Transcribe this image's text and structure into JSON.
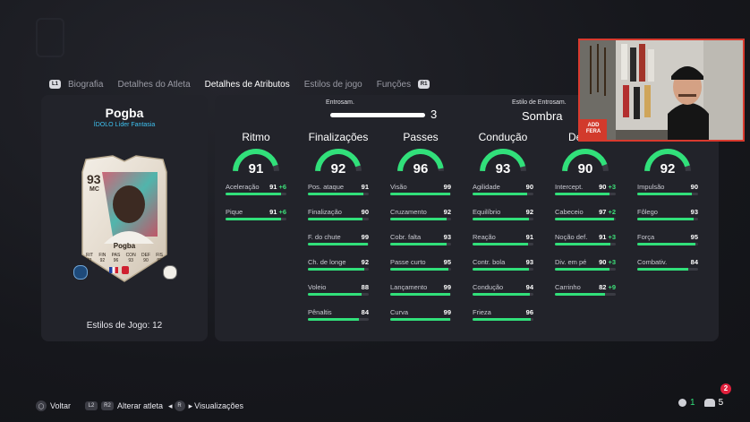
{
  "tabs": {
    "left_button": "L1",
    "right_button": "R1",
    "items": [
      "Biografia",
      "Detalhes do Atleta",
      "Detalhes de Atributos",
      "Estilos de jogo",
      "Funções"
    ],
    "active_index": 2
  },
  "player": {
    "name": "Pogba",
    "tag": "ÍDOLO Líder Fantasia",
    "styles_label": "Estilos de Jogo: 12",
    "card": {
      "rating": "93",
      "position": "MC",
      "name": "Pogba",
      "stat_labels": [
        "RIT",
        "FIN",
        "PAS",
        "CON",
        "DEF",
        "FIS"
      ],
      "stat_values": [
        "91",
        "92",
        "96",
        "93",
        "90",
        "92"
      ]
    }
  },
  "chemistry": {
    "label": "Entrosam.",
    "value": "3",
    "level": 1.0,
    "style_label": "Estilo de Entrosam.",
    "style_value": "Sombra"
  },
  "categories": [
    {
      "title": "Ritmo",
      "value": "91",
      "stats": [
        {
          "label": "Aceleração",
          "value": "91",
          "bonus": "+6"
        },
        {
          "label": "Pique",
          "value": "91",
          "bonus": "+6"
        }
      ]
    },
    {
      "title": "Finalizações",
      "value": "92",
      "stats": [
        {
          "label": "Pos. ataque",
          "value": "91",
          "bonus": ""
        },
        {
          "label": "Finalização",
          "value": "90",
          "bonus": ""
        },
        {
          "label": "F. do chute",
          "value": "99",
          "bonus": ""
        },
        {
          "label": "Ch. de longe",
          "value": "92",
          "bonus": ""
        },
        {
          "label": "Voleio",
          "value": "88",
          "bonus": ""
        },
        {
          "label": "Pênaltis",
          "value": "84",
          "bonus": ""
        }
      ]
    },
    {
      "title": "Passes",
      "value": "96",
      "stats": [
        {
          "label": "Visão",
          "value": "99",
          "bonus": ""
        },
        {
          "label": "Cruzamento",
          "value": "92",
          "bonus": ""
        },
        {
          "label": "Cobr. falta",
          "value": "93",
          "bonus": ""
        },
        {
          "label": "Passe curto",
          "value": "95",
          "bonus": ""
        },
        {
          "label": "Lançamento",
          "value": "99",
          "bonus": ""
        },
        {
          "label": "Curva",
          "value": "99",
          "bonus": ""
        }
      ]
    },
    {
      "title": "Condução",
      "value": "93",
      "stats": [
        {
          "label": "Agilidade",
          "value": "90",
          "bonus": ""
        },
        {
          "label": "Equilíbrio",
          "value": "92",
          "bonus": ""
        },
        {
          "label": "Reação",
          "value": "91",
          "bonus": ""
        },
        {
          "label": "Contr. bola",
          "value": "93",
          "bonus": ""
        },
        {
          "label": "Condução",
          "value": "94",
          "bonus": ""
        },
        {
          "label": "Frieza",
          "value": "96",
          "bonus": ""
        }
      ]
    },
    {
      "title": "Defesa",
      "value": "90",
      "stats": [
        {
          "label": "Intercept.",
          "value": "90",
          "bonus": "+3"
        },
        {
          "label": "Cabeceio",
          "value": "97",
          "bonus": "+2"
        },
        {
          "label": "Noção def.",
          "value": "91",
          "bonus": "+3"
        },
        {
          "label": "Div. em pé",
          "value": "90",
          "bonus": "+3"
        },
        {
          "label": "Carrinho",
          "value": "82",
          "bonus": "+9"
        }
      ]
    },
    {
      "title": "Físico",
      "value": "92",
      "stats": [
        {
          "label": "Impulsão",
          "value": "90",
          "bonus": ""
        },
        {
          "label": "Fôlego",
          "value": "93",
          "bonus": ""
        },
        {
          "label": "Força",
          "value": "95",
          "bonus": ""
        },
        {
          "label": "Combativ.",
          "value": "84",
          "bonus": ""
        }
      ]
    }
  ],
  "bottom_bar": {
    "back": {
      "button": "◯",
      "label": "Voltar"
    },
    "switch": {
      "buttons": [
        "L2",
        "R2"
      ],
      "label": "Alterar atleta"
    },
    "views": {
      "button": "R",
      "label": "Visualizações"
    }
  },
  "status": {
    "first": "1",
    "second": "5",
    "notifications": "2"
  },
  "webcam": {
    "logo_text": "ADD\nFERA"
  },
  "colors": {
    "accent": "#31e07a",
    "track": "#3a3b43",
    "panel": "#22232a",
    "bg": "#15161b",
    "tag": "#3ec1f0"
  }
}
